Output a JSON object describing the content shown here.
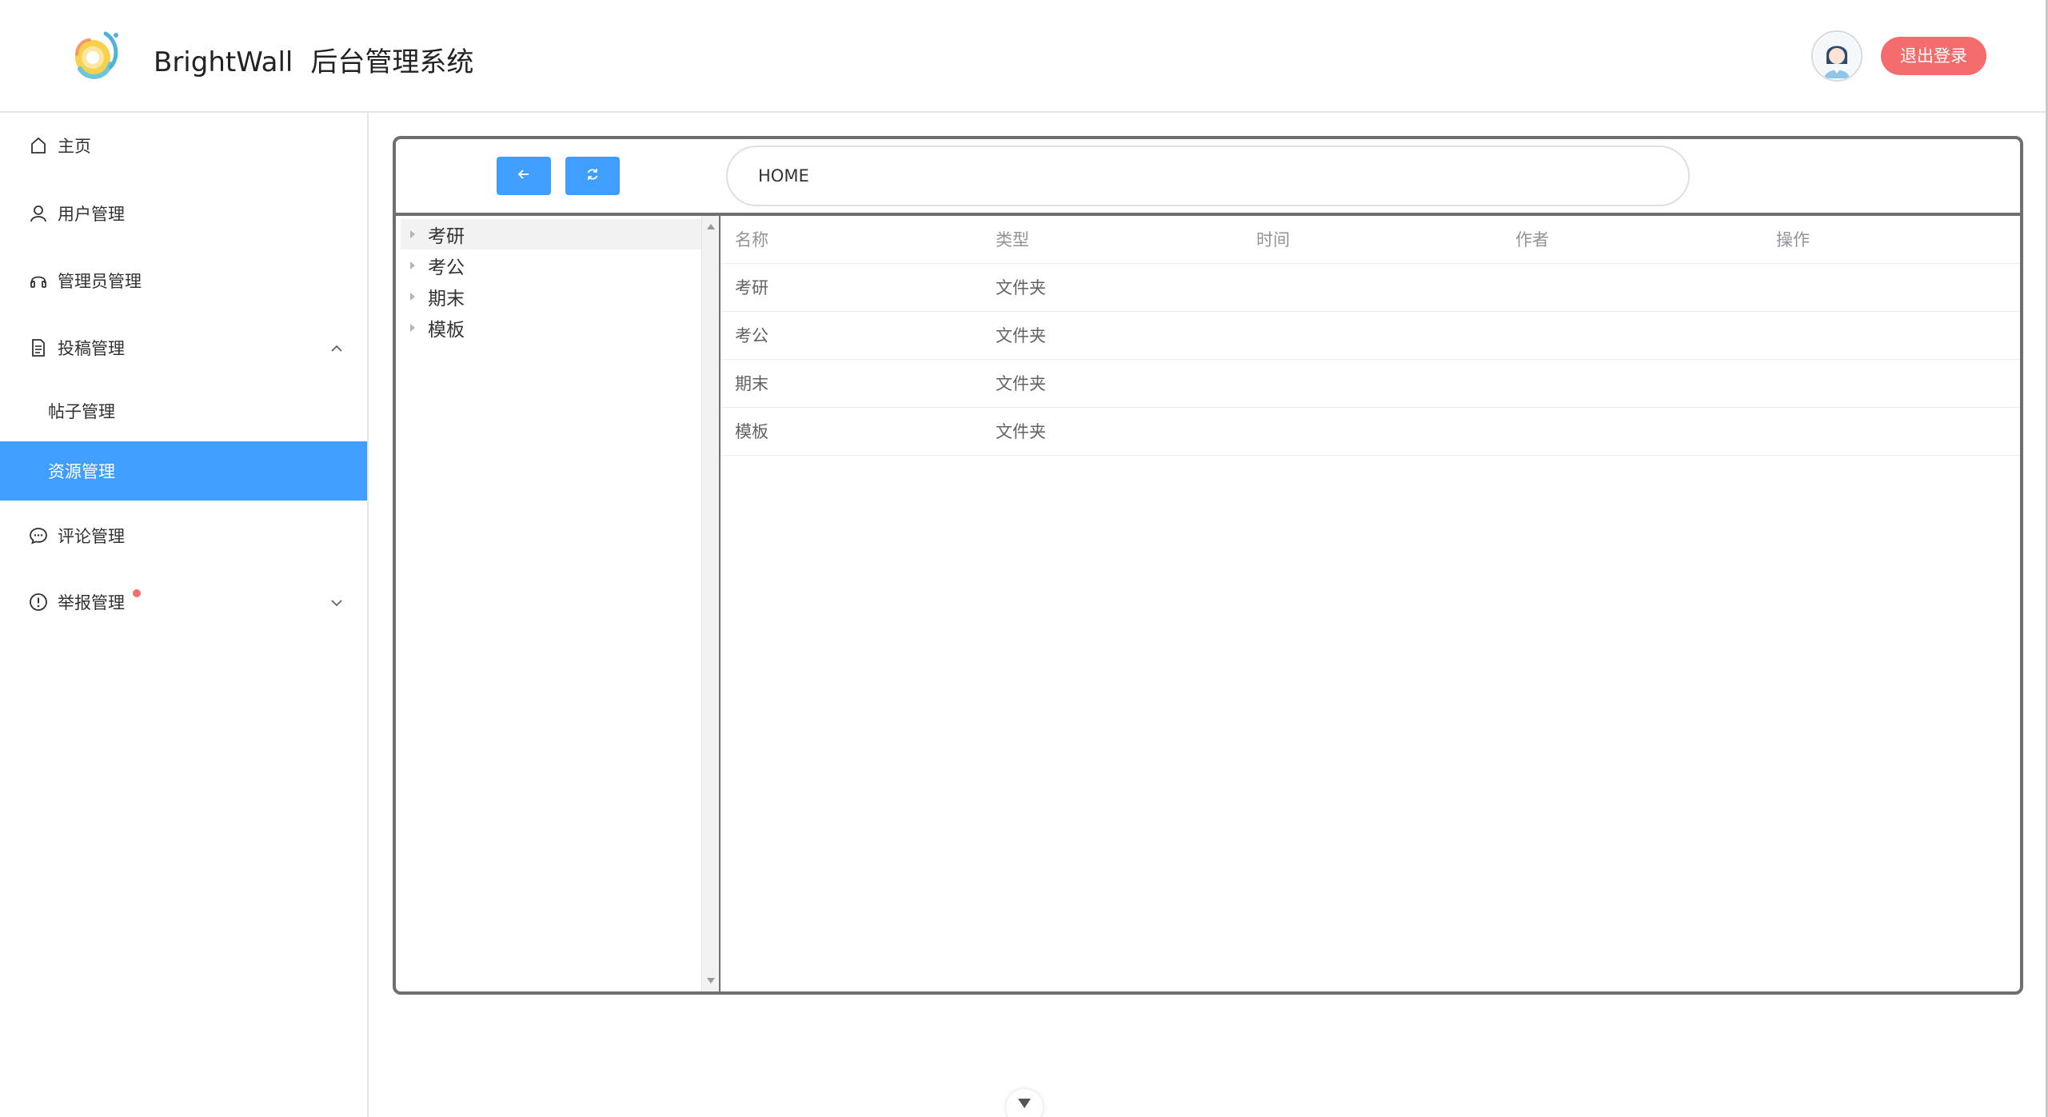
{
  "header": {
    "app_name": "BrightWall",
    "app_subtitle": "后台管理系统",
    "logout_label": "退出登录",
    "logo_icon": "brightwall-logo-icon",
    "avatar_icon": "user-avatar-icon"
  },
  "sidebar": {
    "items": [
      {
        "label": "主页",
        "icon": "home-icon"
      },
      {
        "label": "用户管理",
        "icon": "user-icon"
      },
      {
        "label": "管理员管理",
        "icon": "headset-icon"
      },
      {
        "label": "投稿管理",
        "icon": "document-icon",
        "expanded": true,
        "children": [
          {
            "label": "帖子管理",
            "active": false
          },
          {
            "label": "资源管理",
            "active": true
          }
        ]
      },
      {
        "label": "评论管理",
        "icon": "chat-icon"
      },
      {
        "label": "举报管理",
        "icon": "warning-icon",
        "has_badge": true,
        "expanded": false
      }
    ]
  },
  "toolbar": {
    "back_icon": "arrow-left-icon",
    "refresh_icon": "refresh-icon",
    "path_value": "HOME"
  },
  "tree": {
    "nodes": [
      {
        "label": "考研",
        "highlighted": true
      },
      {
        "label": "考公",
        "highlighted": false
      },
      {
        "label": "期末",
        "highlighted": false
      },
      {
        "label": "模板",
        "highlighted": false
      }
    ]
  },
  "table": {
    "columns": [
      "名称",
      "类型",
      "时间",
      "作者",
      "操作"
    ],
    "rows": [
      {
        "name": "考研",
        "type": "文件夹",
        "time": "",
        "author": "",
        "action": ""
      },
      {
        "name": "考公",
        "type": "文件夹",
        "time": "",
        "author": "",
        "action": ""
      },
      {
        "name": "期末",
        "type": "文件夹",
        "time": "",
        "author": "",
        "action": ""
      },
      {
        "name": "模板",
        "type": "文件夹",
        "time": "",
        "author": "",
        "action": ""
      }
    ]
  },
  "colors": {
    "primary": "#409eff",
    "danger": "#f56c6c",
    "badge": "#f56c6c"
  }
}
